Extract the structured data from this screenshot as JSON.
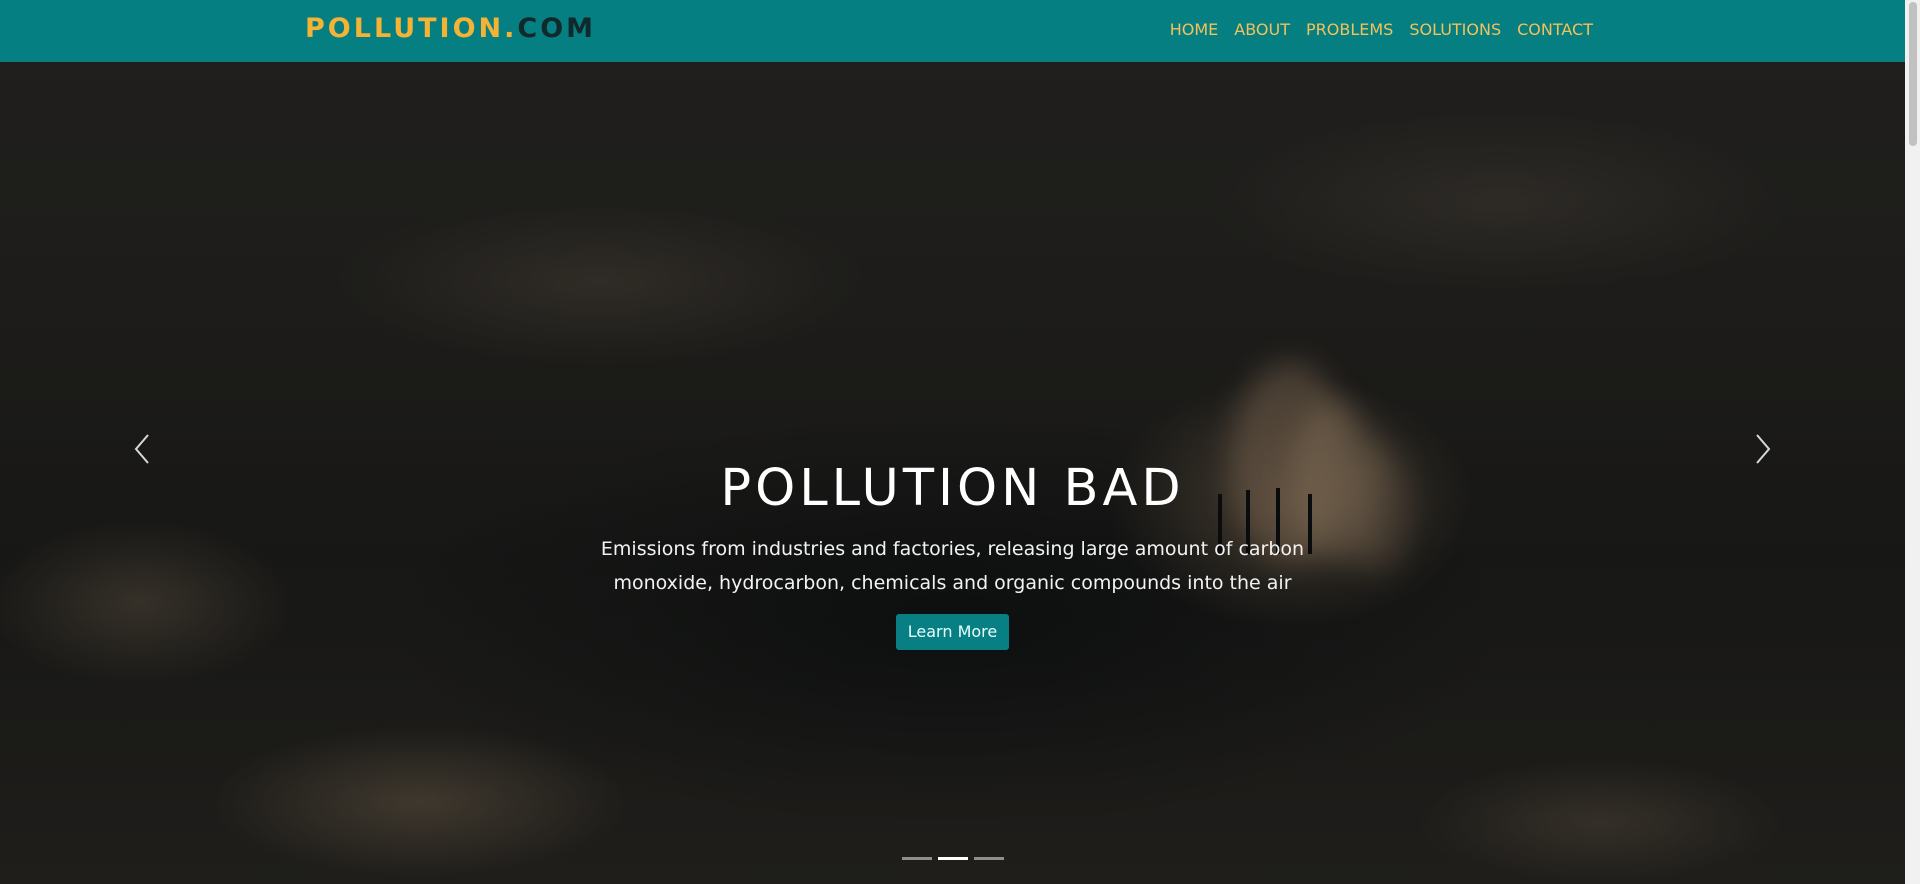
{
  "brand": {
    "main": "POLLUTION",
    "dot": ".",
    "tld": "COM"
  },
  "nav": {
    "items": [
      {
        "label": "HOME"
      },
      {
        "label": "ABOUT"
      },
      {
        "label": "PROBLEMS"
      },
      {
        "label": "SOLUTIONS"
      },
      {
        "label": "CONTACT"
      }
    ]
  },
  "hero": {
    "title": "POLLUTION BAD",
    "text": "Emissions from industries and factories, releasing large amount of carbon monoxide, hydrocarbon, chemicals and organic compounds into the air",
    "button_label": "Learn More",
    "prev_icon": "chevron-left-icon",
    "next_icon": "chevron-right-icon",
    "active_slide": 2,
    "slide_count": 3
  },
  "colors": {
    "navbar": "#057f82",
    "brand_accent": "#f5b335",
    "brand_dark": "#10292b",
    "nav_link": "#f3c25a",
    "button": "#087f83"
  }
}
